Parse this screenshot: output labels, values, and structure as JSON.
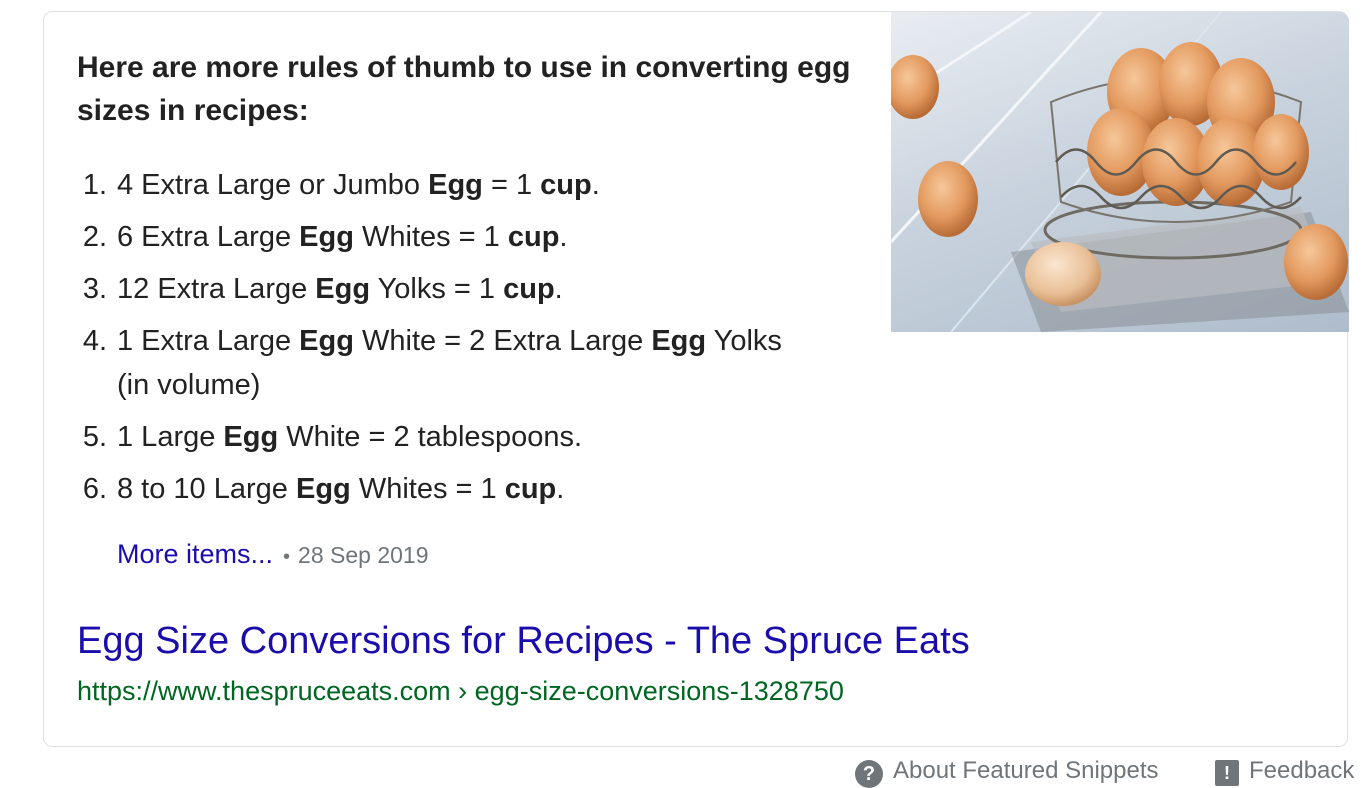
{
  "snippet": {
    "heading": "Here are more rules of thumb to use in converting egg sizes in recipes:",
    "steps": [
      {
        "num": "1.",
        "parts": [
          {
            "t": "4 Extra Large or Jumbo "
          },
          {
            "t": "Egg",
            "b": true
          },
          {
            "t": " = 1 "
          },
          {
            "t": "cup",
            "b": true
          },
          {
            "t": "."
          }
        ]
      },
      {
        "num": "2.",
        "parts": [
          {
            "t": "6 Extra Large "
          },
          {
            "t": "Egg",
            "b": true
          },
          {
            "t": " Whites = 1 "
          },
          {
            "t": "cup",
            "b": true
          },
          {
            "t": "."
          }
        ]
      },
      {
        "num": "3.",
        "parts": [
          {
            "t": "12 Extra Large "
          },
          {
            "t": "Egg",
            "b": true
          },
          {
            "t": " Yolks = 1 "
          },
          {
            "t": "cup",
            "b": true
          },
          {
            "t": "."
          }
        ]
      },
      {
        "num": "4.",
        "parts": [
          {
            "t": "1 Extra Large "
          },
          {
            "t": "Egg",
            "b": true
          },
          {
            "t": " White = 2 Extra Large "
          },
          {
            "t": "Egg",
            "b": true
          },
          {
            "t": " Yolks (in volume)"
          }
        ]
      },
      {
        "num": "5.",
        "parts": [
          {
            "t": "1 Large "
          },
          {
            "t": "Egg",
            "b": true
          },
          {
            "t": " White = 2 tablespoons."
          }
        ]
      },
      {
        "num": "6.",
        "parts": [
          {
            "t": "8 to 10 Large "
          },
          {
            "t": "Egg",
            "b": true
          },
          {
            "t": " Whites = 1 "
          },
          {
            "t": "cup",
            "b": true
          },
          {
            "t": "."
          }
        ]
      }
    ],
    "more_items_label": "More items...",
    "separator": "•",
    "date": "28 Sep 2019",
    "image_icon": "egg-basket-image"
  },
  "result": {
    "title": "Egg Size Conversions for Recipes - The Spruce Eats",
    "url": "https://www.thespruceeats.com › egg-size-conversions-1328750"
  },
  "footer": {
    "about_label": "About Featured Snippets",
    "about_icon": "question-icon",
    "feedback_label": "Feedback",
    "feedback_icon": "feedback-icon"
  },
  "colors": {
    "link": "#1a0dab",
    "url_green": "#006621",
    "meta_gray": "#70757a",
    "text": "#222222"
  }
}
